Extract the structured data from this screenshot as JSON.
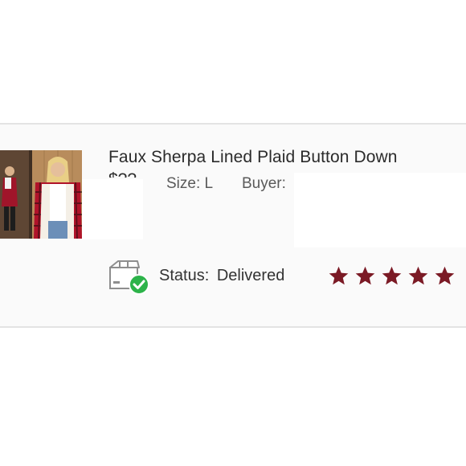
{
  "listing": {
    "title": "Faux Sherpa Lined Plaid Button Down",
    "price_fragment": "$??",
    "size_label": "Size: L",
    "buyer_label": "Buyer:"
  },
  "status": {
    "label": "Status:",
    "value": "Delivered",
    "icon": "delivered-box-icon",
    "check_color": "#2db34a"
  },
  "rating": {
    "value": 5,
    "max": 5,
    "color": "#7b1a25"
  },
  "colors": {
    "plaid_red": "#b0132a",
    "card_bg": "#fafafa"
  }
}
